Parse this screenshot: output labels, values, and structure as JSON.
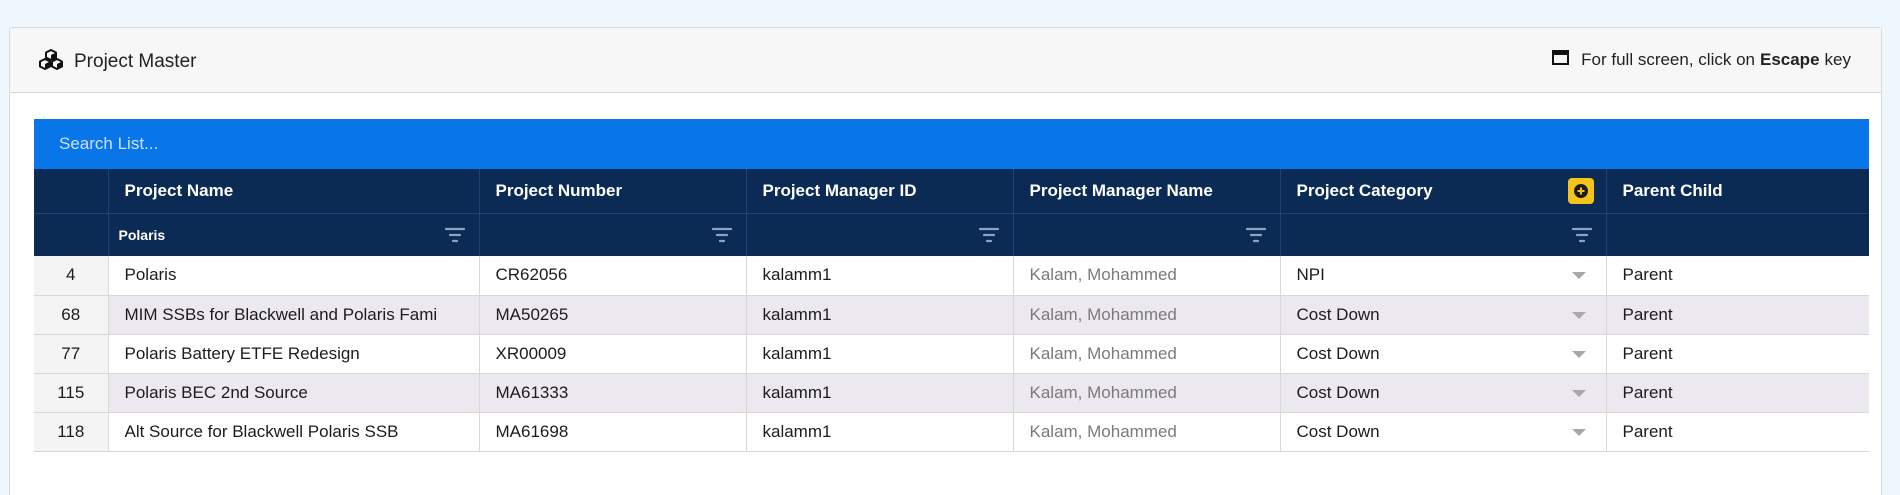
{
  "header": {
    "title": "Project Master",
    "icon": "cubes-icon",
    "fullscreen_prefix": "For full screen, click on",
    "fullscreen_key": "Escape",
    "fullscreen_suffix": "key",
    "fullscreen_icon": "window-icon"
  },
  "search": {
    "placeholder": "Search List..."
  },
  "columns": [
    {
      "label": ""
    },
    {
      "label": "Project Name"
    },
    {
      "label": "Project Number"
    },
    {
      "label": "Project Manager ID"
    },
    {
      "label": "Project Manager Name"
    },
    {
      "label": "Project Category"
    },
    {
      "label": "Parent Child"
    }
  ],
  "filters": {
    "project_name": "Polaris"
  },
  "rows": [
    {
      "id": "4",
      "name": "Polaris",
      "number": "CR62056",
      "mgr_id": "kalamm1",
      "mgr_name": "Kalam, Mohammed",
      "category": "NPI",
      "parent_child": "Parent"
    },
    {
      "id": "68",
      "name": "MIM SSBs for Blackwell and  Polaris Fami",
      "number": "MA50265",
      "mgr_id": "kalamm1",
      "mgr_name": "Kalam, Mohammed",
      "category": "Cost Down",
      "parent_child": "Parent"
    },
    {
      "id": "77",
      "name": "Polaris Battery ETFE Redesign",
      "number": "XR00009",
      "mgr_id": "kalamm1",
      "mgr_name": "Kalam, Mohammed",
      "category": "Cost Down",
      "parent_child": "Parent"
    },
    {
      "id": "115",
      "name": "Polaris BEC 2nd Source",
      "number": "MA61333",
      "mgr_id": "kalamm1",
      "mgr_name": "Kalam, Mohammed",
      "category": "Cost Down",
      "parent_child": "Parent"
    },
    {
      "id": "118",
      "name": "Alt Source for Blackwell Polaris SSB",
      "number": "MA61698",
      "mgr_id": "kalamm1",
      "mgr_name": "Kalam, Mohammed",
      "category": "Cost Down",
      "parent_child": "Parent"
    }
  ],
  "colors": {
    "search_bar": "#0875e8",
    "header_bg": "#0b2a54",
    "accent_button": "#f5c41b",
    "row_alt": "#ece8ef"
  }
}
